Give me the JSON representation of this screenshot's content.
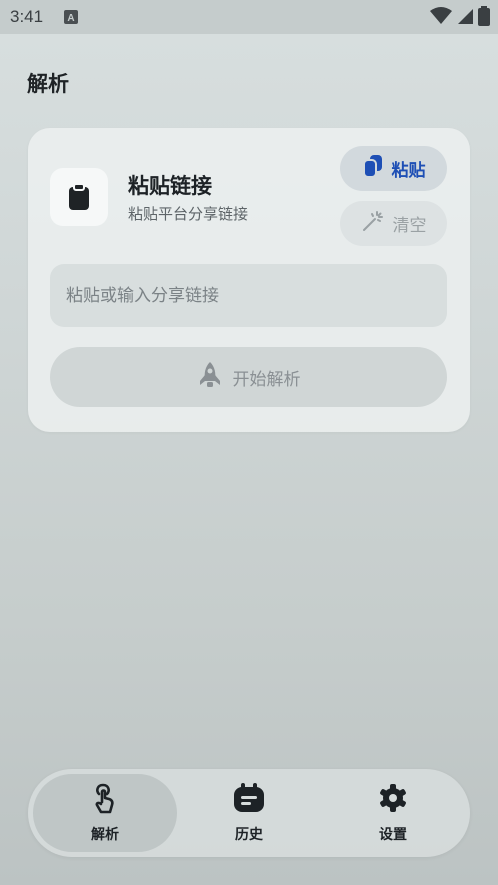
{
  "status_bar": {
    "time": "3:41"
  },
  "page": {
    "title": "解析"
  },
  "card": {
    "title": "粘贴链接",
    "subtitle": "粘贴平台分享链接",
    "paste_label": "粘贴",
    "clear_label": "清空",
    "input_placeholder": "粘贴或输入分享链接",
    "input_value": "",
    "start_label": "开始解析"
  },
  "nav": {
    "items": [
      {
        "label": "解析",
        "icon": "tap-icon",
        "active": true
      },
      {
        "label": "历史",
        "icon": "history-icon",
        "active": false
      },
      {
        "label": "设置",
        "icon": "gear-icon",
        "active": false
      }
    ]
  },
  "colors": {
    "accent": "#1e4fb5",
    "disabled": "#9aa1a4"
  }
}
